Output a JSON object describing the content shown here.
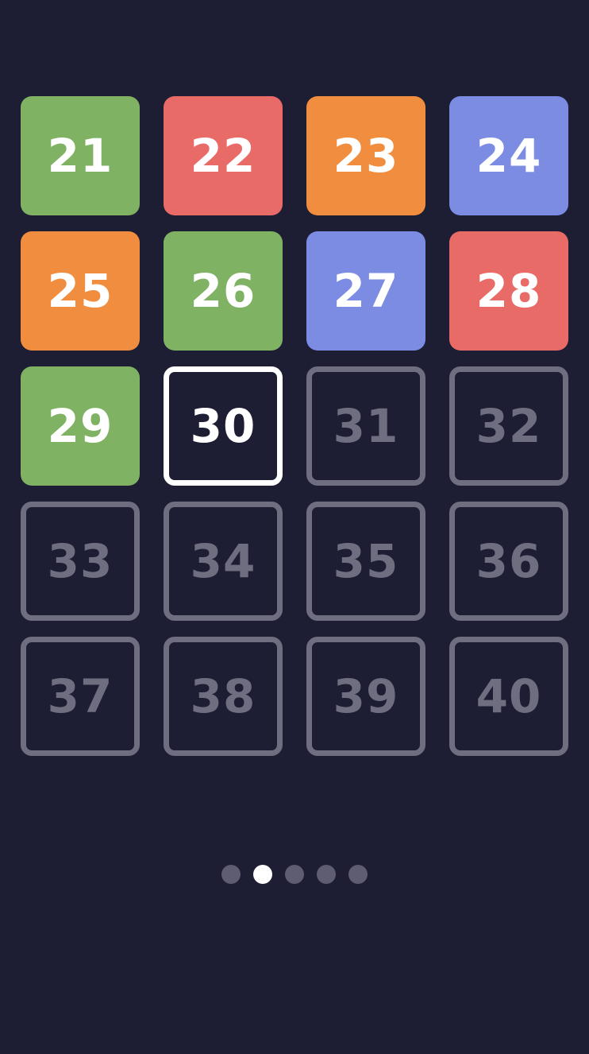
{
  "colors": {
    "background": "#1d1d33",
    "green": "#7fb263",
    "red": "#e96b67",
    "orange": "#f08d3e",
    "blue": "#7b8ce2",
    "locked": "#6f6e80",
    "current": "#ffffff",
    "dot_inactive": "#5e5d71",
    "dot_active": "#ffffff"
  },
  "levels": [
    {
      "number": "21",
      "state": "done",
      "color": "green"
    },
    {
      "number": "22",
      "state": "done",
      "color": "red"
    },
    {
      "number": "23",
      "state": "done",
      "color": "orange"
    },
    {
      "number": "24",
      "state": "done",
      "color": "blue"
    },
    {
      "number": "25",
      "state": "done",
      "color": "orange"
    },
    {
      "number": "26",
      "state": "done",
      "color": "green"
    },
    {
      "number": "27",
      "state": "done",
      "color": "blue"
    },
    {
      "number": "28",
      "state": "done",
      "color": "red"
    },
    {
      "number": "29",
      "state": "done",
      "color": "green"
    },
    {
      "number": "30",
      "state": "current"
    },
    {
      "number": "31",
      "state": "locked"
    },
    {
      "number": "32",
      "state": "locked"
    },
    {
      "number": "33",
      "state": "locked"
    },
    {
      "number": "34",
      "state": "locked"
    },
    {
      "number": "35",
      "state": "locked"
    },
    {
      "number": "36",
      "state": "locked"
    },
    {
      "number": "37",
      "state": "locked"
    },
    {
      "number": "38",
      "state": "locked"
    },
    {
      "number": "39",
      "state": "locked"
    },
    {
      "number": "40",
      "state": "locked"
    }
  ],
  "pagination": {
    "total_pages": 5,
    "current_page": 2
  }
}
